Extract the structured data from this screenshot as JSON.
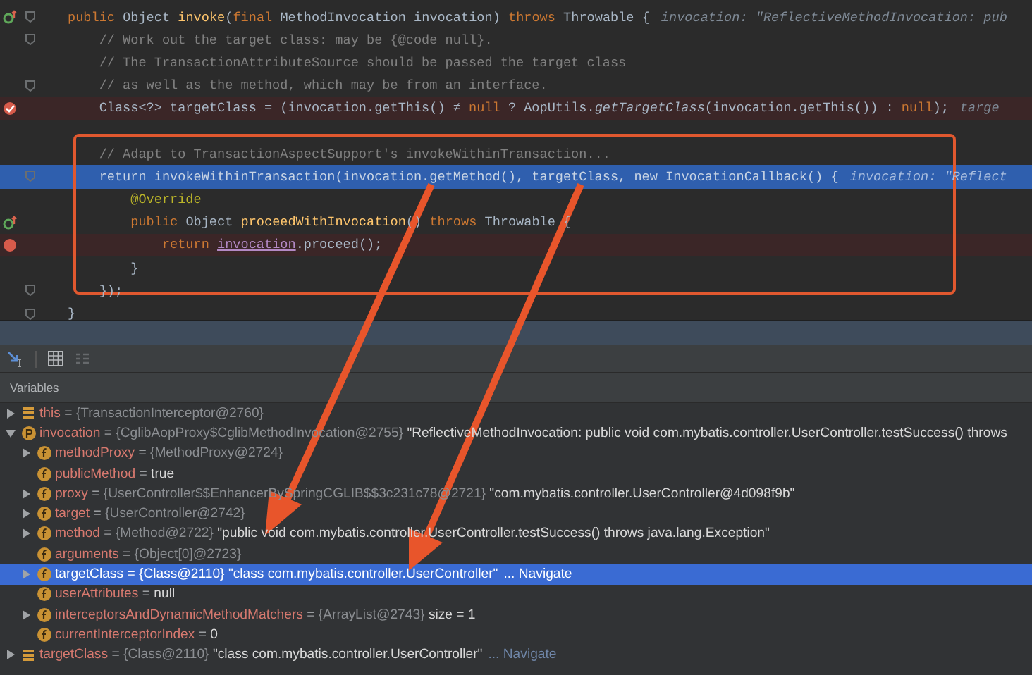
{
  "code_lines": [
    {
      "kind": "code",
      "breakpoint": false,
      "execution_point": false,
      "override": true,
      "fold": true,
      "segments": [
        {
          "kind": "kw",
          "t": "public "
        },
        {
          "kind": "plain",
          "t": "Object "
        },
        {
          "kind": "method",
          "t": "invoke"
        },
        {
          "kind": "plain",
          "t": "("
        },
        {
          "kind": "kw",
          "t": "final "
        },
        {
          "kind": "plain",
          "t": "MethodInvocation invocation) "
        },
        {
          "kind": "kw",
          "t": "throws "
        },
        {
          "kind": "plain",
          "t": "Throwable {"
        }
      ],
      "hint": "invocation: \"ReflectiveMethodInvocation: pub"
    },
    {
      "kind": "code",
      "breakpoint": false,
      "execution_point": false,
      "override": false,
      "fold": true,
      "segments": [
        {
          "kind": "comment",
          "t": "    // Work out the target class: may be {@code null}."
        }
      ]
    },
    {
      "kind": "code",
      "breakpoint": false,
      "execution_point": false,
      "override": false,
      "fold": false,
      "segments": [
        {
          "kind": "comment",
          "t": "    // The TransactionAttributeSource should be passed the target class"
        }
      ]
    },
    {
      "kind": "code",
      "breakpoint": false,
      "execution_point": false,
      "override": false,
      "fold": true,
      "segments": [
        {
          "kind": "comment",
          "t": "    // as well as the method, which may be from an interface."
        }
      ]
    },
    {
      "kind": "code",
      "breakpoint": true,
      "verified": true,
      "execution_point": false,
      "override": false,
      "fold": false,
      "segments": [
        {
          "kind": "plain",
          "t": "    Class<?> targetClass = (invocation.getThis() ≠ "
        },
        {
          "kind": "kw",
          "t": "null"
        },
        {
          "kind": "plain",
          "t": " ? AopUtils."
        },
        {
          "kind": "italic",
          "t": "getTargetClass"
        },
        {
          "kind": "plain",
          "t": "(invocation.getThis()) : "
        },
        {
          "kind": "kw",
          "t": "null"
        },
        {
          "kind": "plain",
          "t": ");"
        }
      ],
      "hint": "targe"
    },
    {
      "kind": "blank",
      "breakpoint": false,
      "execution_point": false,
      "override": false,
      "fold": false
    },
    {
      "kind": "code",
      "breakpoint": false,
      "execution_point": false,
      "override": false,
      "fold": false,
      "segments": [
        {
          "kind": "comment",
          "t": "    // Adapt to TransactionAspectSupport's invokeWithinTransaction..."
        }
      ]
    },
    {
      "kind": "code",
      "breakpoint": false,
      "execution_point": true,
      "override": false,
      "fold": true,
      "segments": [
        {
          "kind": "kw",
          "t": "    return "
        },
        {
          "kind": "plain",
          "t": "invokeWithinTransaction(invocation.getMethod(), targetClass, "
        },
        {
          "kind": "kw",
          "t": "new "
        },
        {
          "kind": "plain",
          "t": "InvocationCallback() {"
        }
      ],
      "hint": "invocation: \"Reflect"
    },
    {
      "kind": "code",
      "breakpoint": false,
      "execution_point": false,
      "override": false,
      "fold": false,
      "segments": [
        {
          "kind": "ann",
          "t": "        @Override"
        }
      ]
    },
    {
      "kind": "code",
      "breakpoint": false,
      "execution_point": false,
      "override": true,
      "fold": false,
      "segments": [
        {
          "kind": "kw",
          "t": "        public "
        },
        {
          "kind": "plain",
          "t": "Object "
        },
        {
          "kind": "method",
          "t": "proceedWithInvocation"
        },
        {
          "kind": "plain",
          "t": "() "
        },
        {
          "kind": "kw",
          "t": "throws "
        },
        {
          "kind": "plain",
          "t": "Throwable {"
        }
      ]
    },
    {
      "kind": "code",
      "breakpoint": true,
      "verified": false,
      "execution_point": false,
      "override": false,
      "fold": false,
      "segments": [
        {
          "kind": "kw",
          "t": "            return "
        },
        {
          "kind": "under",
          "t": "invocation"
        },
        {
          "kind": "plain",
          "t": ".proceed();"
        }
      ]
    },
    {
      "kind": "code",
      "breakpoint": false,
      "execution_point": false,
      "override": false,
      "fold": false,
      "segments": [
        {
          "kind": "plain",
          "t": "        }"
        }
      ]
    },
    {
      "kind": "code",
      "breakpoint": false,
      "execution_point": false,
      "override": false,
      "fold": true,
      "segments": [
        {
          "kind": "plain",
          "t": "    });"
        }
      ]
    },
    {
      "kind": "code",
      "breakpoint": false,
      "execution_point": false,
      "override": false,
      "fold": true,
      "segments": [
        {
          "kind": "plain",
          "t": "}"
        }
      ]
    }
  ],
  "debugger": {
    "panel_title": "Variables",
    "variables": [
      {
        "name": "this",
        "kind": "local",
        "expanded": false,
        "selected": false,
        "op": "=",
        "ref": "{TransactionInterceptor@2760}"
      },
      {
        "name": "invocation",
        "kind": "parameter",
        "expanded": true,
        "selected": false,
        "op": "=",
        "ref": "{CglibAopProxy$CglibMethodInvocation@2755}",
        "value": "\"ReflectiveMethodInvocation: public void com.mybatis.controller.UserController.testSuccess() throws",
        "children": [
          {
            "name": "methodProxy",
            "kind": "field",
            "expanded": false,
            "selected": false,
            "op": "=",
            "ref": "{MethodProxy@2724}"
          },
          {
            "name": "publicMethod",
            "kind": "field",
            "selected": false,
            "op": "=",
            "value": "true"
          },
          {
            "name": "proxy",
            "kind": "field",
            "expanded": false,
            "selected": false,
            "op": "=",
            "ref": "{UserController$$EnhancerBySpringCGLIB$$3c231c78@2721}",
            "value": "\"com.mybatis.controller.UserController@4d098f9b\""
          },
          {
            "name": "target",
            "kind": "field",
            "expanded": false,
            "selected": false,
            "op": "=",
            "ref": "{UserController@2742}"
          },
          {
            "name": "method",
            "kind": "field",
            "expanded": false,
            "selected": false,
            "op": "=",
            "ref": "{Method@2722}",
            "value": "\"public void com.mybatis.controller.UserController.testSuccess() throws java.lang.Exception\""
          },
          {
            "name": "arguments",
            "kind": "field",
            "selected": false,
            "op": "=",
            "ref": "{Object[0]@2723}"
          },
          {
            "name": "targetClass",
            "kind": "field",
            "expanded": false,
            "selected": true,
            "op": "=",
            "ref": "{Class@2110}",
            "value": "\"class com.mybatis.controller.UserController\"",
            "link": "... Navigate"
          },
          {
            "name": "userAttributes",
            "kind": "field",
            "selected": false,
            "op": "=",
            "value": "null"
          },
          {
            "name": "interceptorsAndDynamicMethodMatchers",
            "kind": "field",
            "expanded": false,
            "selected": false,
            "op": "=",
            "ref": "{ArrayList@2743}",
            "value": "size = 1"
          },
          {
            "name": "currentInterceptorIndex",
            "kind": "field",
            "selected": false,
            "op": "=",
            "value": "0"
          }
        ]
      },
      {
        "name": "targetClass",
        "kind": "local",
        "expanded": false,
        "selected": false,
        "op": "=",
        "ref": "{Class@2110}",
        "value": "\"class com.mybatis.controller.UserController\"",
        "link": "... Navigate"
      }
    ]
  }
}
